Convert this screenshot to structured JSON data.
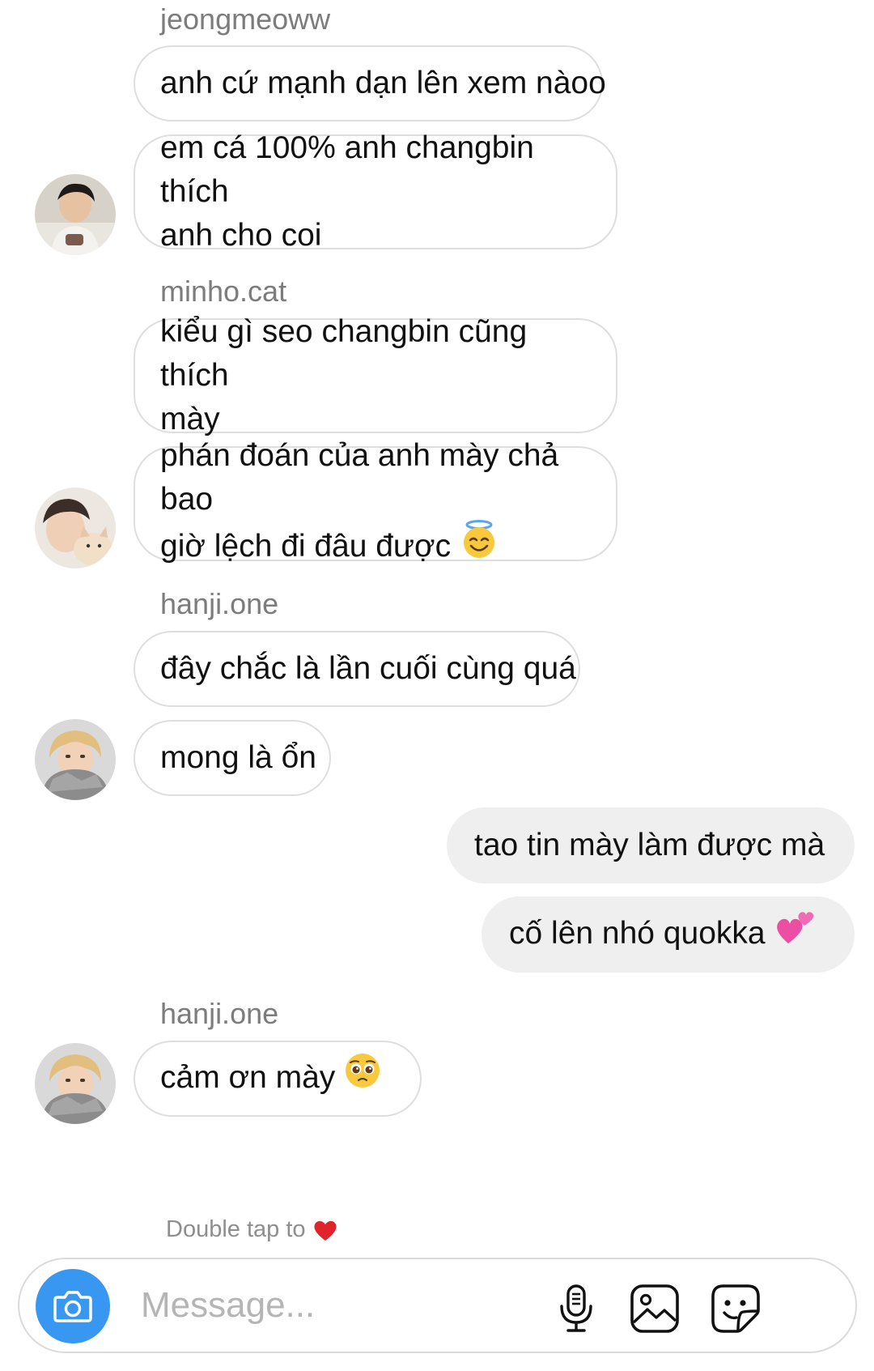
{
  "thread": {
    "groups": [
      {
        "sender": "jeongmeoww",
        "messages": [
          "anh cứ mạnh dạn lên xem nàoo",
          "em cá 100% anh changbin thích\nanh cho coi"
        ]
      },
      {
        "sender": "minho.cat",
        "messages": [
          "kiểu gì seo changbin cũng thích\nmày",
          "phán đoán của anh mày chả bao\ngiờ lệch đi đâu được"
        ]
      },
      {
        "sender": "hanji.one",
        "messages": [
          "đây chắc là lần cuối cùng quá",
          "mong là ổn"
        ]
      },
      {
        "sender": "me",
        "messages": [
          "tao tin mày làm được mà",
          "cố lên nhó quokka"
        ]
      },
      {
        "sender": "hanji.one",
        "messages": [
          "cảm ơn mày"
        ]
      }
    ],
    "emojis": {
      "halo": "smiling-face-with-halo",
      "hearts": "two-hearts",
      "pleading": "pleading-face",
      "like": "red-heart"
    }
  },
  "reaction_hint": {
    "text": "Double tap to"
  },
  "composer": {
    "placeholder": "Message...",
    "camera_icon": "camera-icon",
    "mic_icon": "microphone-icon",
    "gallery_icon": "image-icon",
    "sticker_icon": "sticker-icon"
  },
  "colors": {
    "accent": "#3897f0",
    "incoming_border": "#dedede",
    "outgoing_bubble": "#efefef",
    "username": "#7c7c7c",
    "hint": "#8e8e8e"
  }
}
